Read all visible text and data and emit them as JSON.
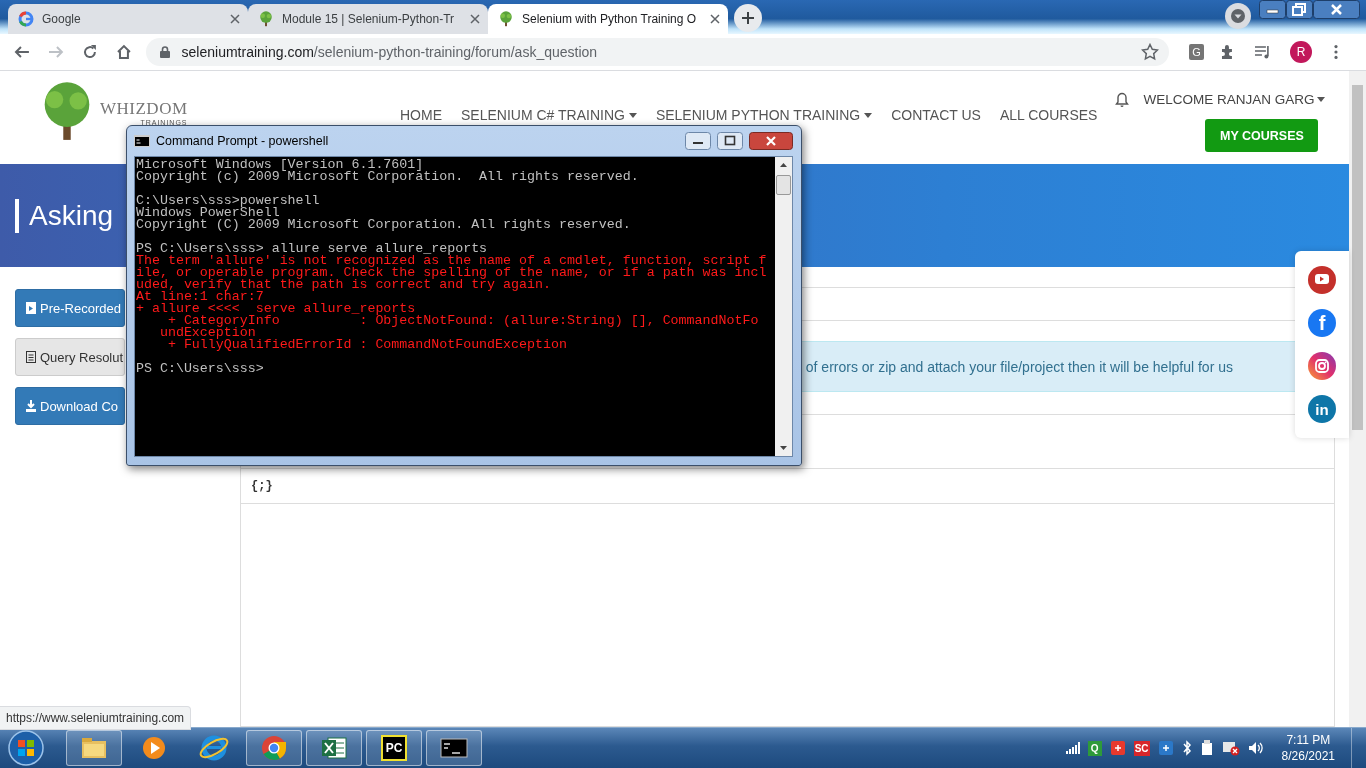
{
  "browser": {
    "tabs": [
      {
        "title": "Google",
        "selected": false
      },
      {
        "title": "Module 15 | Selenium-Python-Tr",
        "selected": false
      },
      {
        "title": "Selenium with Python Training O",
        "selected": true
      }
    ],
    "url_host": "seleniumtraining.com",
    "url_path": "/selenium-python-training/forum/ask_question",
    "extension_label": "G",
    "avatar_letter": "R",
    "status_url": "https://www.seleniumtraining.com"
  },
  "site": {
    "logo": {
      "name": "WHIZDOM",
      "tagline": "TRAININGS"
    },
    "nav": [
      {
        "label": "HOME",
        "dropdown": false
      },
      {
        "label": "SELENIUM C# TRAINING",
        "dropdown": true
      },
      {
        "label": "SELENIUM PYTHON TRAINING",
        "dropdown": true
      },
      {
        "label": "CONTACT US",
        "dropdown": false
      },
      {
        "label": "ALL COURSES",
        "dropdown": false
      }
    ],
    "welcome": "WELCOME RANJAN GARG",
    "my_courses": "MY COURSES",
    "page_title": "Asking",
    "sidebar_buttons": [
      {
        "label": "Pre-Recorded"
      },
      {
        "label": "Query Resolut"
      },
      {
        "label": "Download Co"
      }
    ],
    "notice": "of errors or zip and attach your file/project then it will be helpful for us",
    "editor_button": "{;}",
    "social": [
      {
        "kind": "youtube"
      },
      {
        "kind": "facebook",
        "glyph": "f"
      },
      {
        "kind": "instagram"
      },
      {
        "kind": "linkedin",
        "glyph": "in"
      }
    ]
  },
  "console": {
    "title": "Command Prompt - powershell",
    "blocks": [
      [
        {
          "text": "Microsoft Windows [Version 6.1.7601]",
          "kind": "output"
        },
        {
          "text": "Copyright (c) 2009 Microsoft Corporation.  All rights reserved.",
          "kind": "output"
        }
      ],
      [
        {
          "text": "C:\\Users\\sss>powershell",
          "kind": "output"
        },
        {
          "text": "Windows PowerShell",
          "kind": "output"
        },
        {
          "text": "Copyright (C) 2009 Microsoft Corporation. All rights reserved.",
          "kind": "output"
        }
      ],
      [
        {
          "text": "PS C:\\Users\\sss> allure serve allure_reports",
          "kind": "output"
        },
        {
          "text": "The term 'allure' is not recognized as the name of a cmdlet, function, script f",
          "kind": "error"
        },
        {
          "text": "ile, or operable program. Check the spelling of the name, or if a path was incl",
          "kind": "error"
        },
        {
          "text": "uded, verify that the path is correct and try again.",
          "kind": "error"
        },
        {
          "text": "At line:1 char:7",
          "kind": "error"
        },
        {
          "text": "+ allure <<<<  serve allure_reports",
          "kind": "error"
        },
        {
          "text": "    + CategoryInfo          : ObjectNotFound: (allure:String) [], CommandNotFo",
          "kind": "error"
        },
        {
          "text": "   undException",
          "kind": "error"
        },
        {
          "text": "    + FullyQualifiedErrorId : CommandNotFoundException",
          "kind": "error"
        }
      ],
      [
        {
          "text": "PS C:\\Users\\sss>",
          "kind": "output"
        }
      ]
    ]
  },
  "taskbar": {
    "apps": [
      {
        "kind": "explorer",
        "running": true
      },
      {
        "kind": "media",
        "running": false
      },
      {
        "kind": "ie",
        "running": false
      },
      {
        "kind": "chrome",
        "running": true
      },
      {
        "kind": "excel",
        "running": true
      },
      {
        "kind": "pycharm",
        "running": true,
        "label": "PC"
      },
      {
        "kind": "terminal",
        "running": true
      }
    ],
    "tray": [
      {
        "kind": "signal"
      },
      {
        "kind": "letter",
        "text": "Q",
        "color": "#2e9a3a"
      },
      {
        "kind": "square",
        "color": "#e8392d"
      },
      {
        "kind": "letter",
        "text": "SC",
        "color": "#d8262a"
      },
      {
        "kind": "square",
        "color": "#2b78c8"
      },
      {
        "kind": "bluetooth"
      },
      {
        "kind": "device"
      },
      {
        "kind": "flag"
      },
      {
        "kind": "speaker"
      }
    ],
    "time": "7:11 PM",
    "date": "8/26/2021"
  }
}
